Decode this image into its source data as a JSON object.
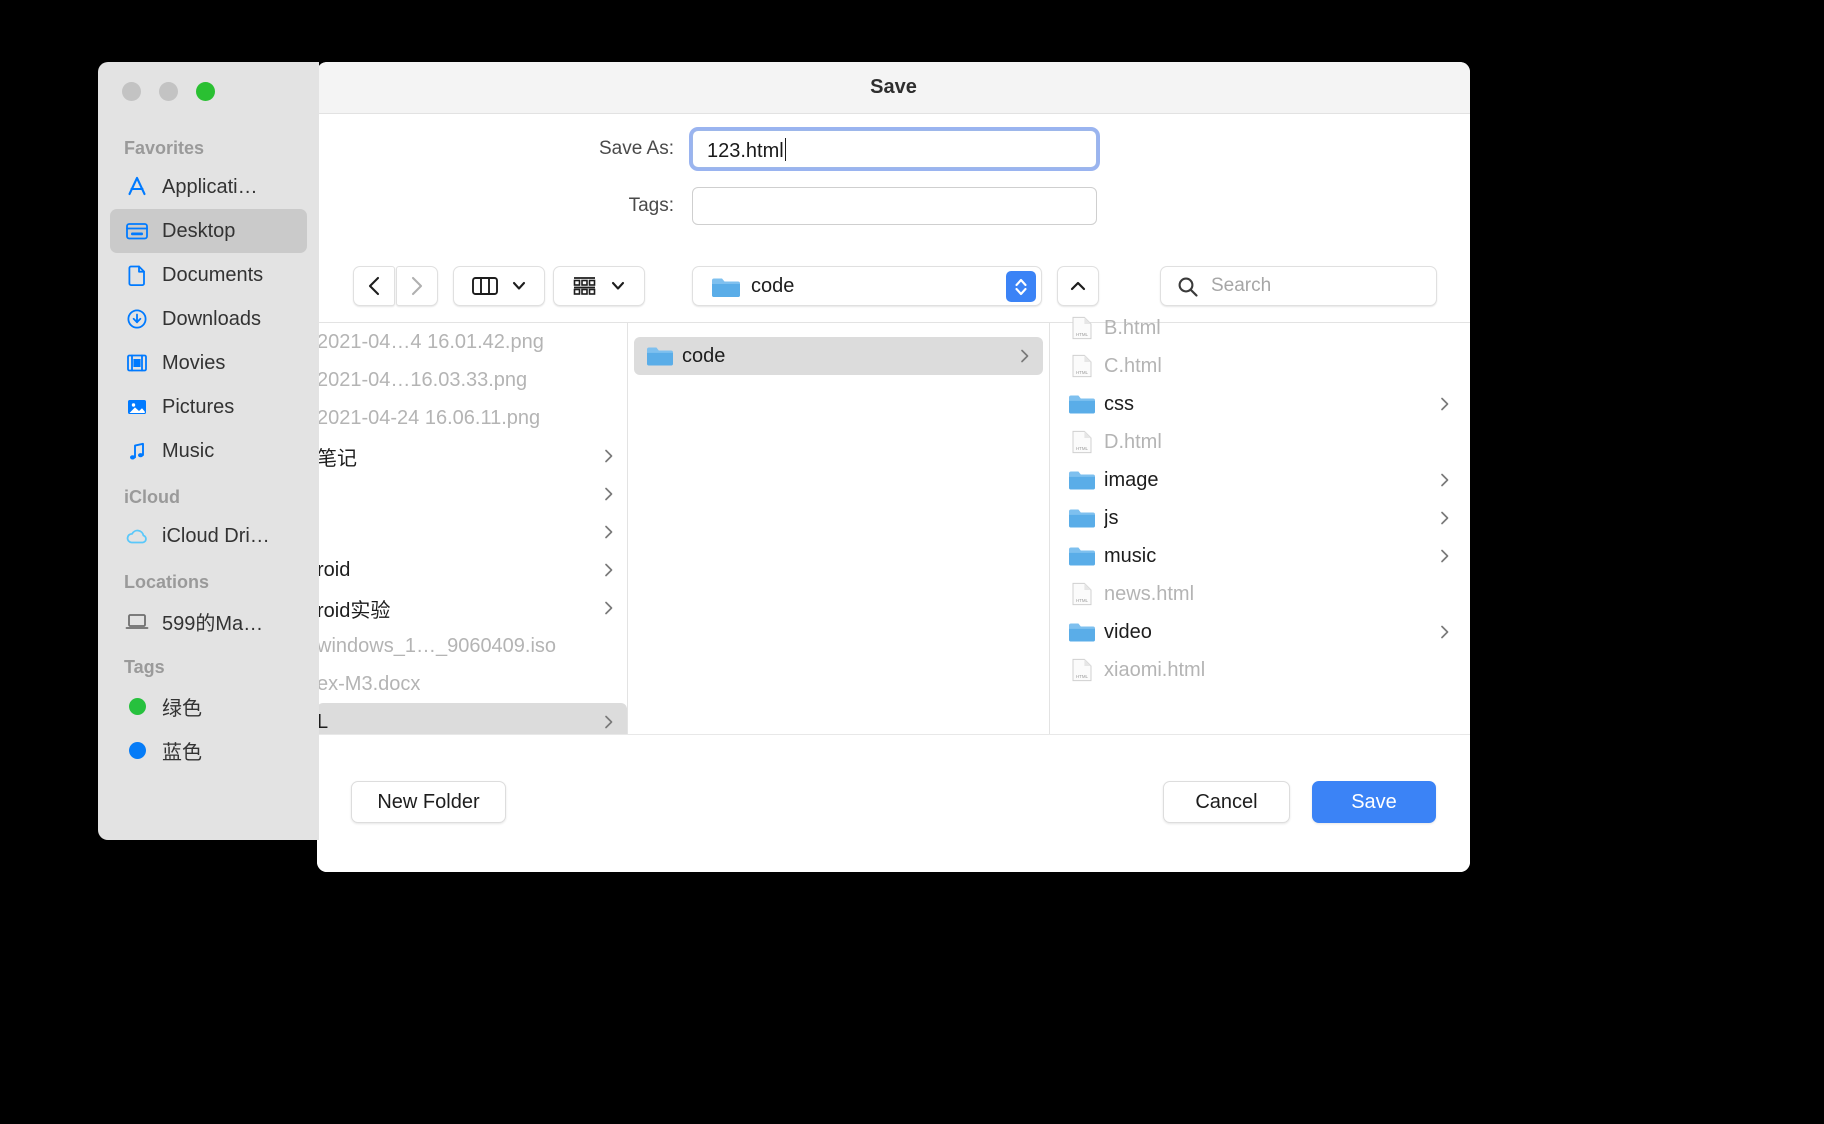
{
  "window": {
    "title": "Save",
    "traffic_lights": [
      "close",
      "minimize",
      "zoom"
    ]
  },
  "form": {
    "save_as_label": "Save As:",
    "save_as_value": "123.html",
    "tags_label": "Tags:",
    "tags_value": "",
    "tags_placeholder": ""
  },
  "toolbar": {
    "back_icon": "chevron-left-icon",
    "forward_icon": "chevron-right-icon",
    "view_mode_icon": "column-view-icon",
    "arrange_icon": "group-items-icon",
    "path_label": "code",
    "path_icon": "folder-icon",
    "stepper_icon": "up-down-chevron-icon",
    "up_icon": "chevron-up-icon",
    "search_icon": "search-icon",
    "search_placeholder": "Search",
    "search_value": ""
  },
  "sidebar": {
    "sections": [
      {
        "header": "Favorites",
        "items": [
          {
            "label": "Applicati…",
            "icon": "applications-icon",
            "color": "#007aff",
            "active": false
          },
          {
            "label": "Desktop",
            "icon": "desktop-icon",
            "color": "#007aff",
            "active": true
          },
          {
            "label": "Documents",
            "icon": "document-icon",
            "color": "#007aff",
            "active": false
          },
          {
            "label": "Downloads",
            "icon": "downloads-icon",
            "color": "#007aff",
            "active": false
          },
          {
            "label": "Movies",
            "icon": "movies-icon",
            "color": "#007aff",
            "active": false
          },
          {
            "label": "Pictures",
            "icon": "pictures-icon",
            "color": "#007aff",
            "active": false
          },
          {
            "label": "Music",
            "icon": "music-icon",
            "color": "#007aff",
            "active": false
          }
        ]
      },
      {
        "header": "iCloud",
        "items": [
          {
            "label": "iCloud Dri…",
            "icon": "icloud-icon",
            "color": "#5ac8fa",
            "active": false
          }
        ]
      },
      {
        "header": "Locations",
        "items": [
          {
            "label": "599的Ma…",
            "icon": "laptop-icon",
            "color": "#6e6e6e",
            "active": false
          }
        ]
      },
      {
        "header": "Tags",
        "items": [
          {
            "label": "绿色",
            "icon": "tag-dot-icon",
            "color": "#27c13e",
            "active": false
          },
          {
            "label": "蓝色",
            "icon": "tag-dot-icon",
            "color": "#067cf7",
            "active": false
          }
        ]
      }
    ]
  },
  "browser": {
    "column1": [
      {
        "label": "2021-04…4 16.01.42.png",
        "type": "file",
        "dim": true,
        "selected": false,
        "has_children": false
      },
      {
        "label": "2021-04…16.03.33.png",
        "type": "file",
        "dim": true,
        "selected": false,
        "has_children": false
      },
      {
        "label": "2021-04-24 16.06.11.png",
        "type": "file",
        "dim": true,
        "selected": false,
        "has_children": false
      },
      {
        "label": "笔记",
        "type": "folder",
        "dim": false,
        "selected": false,
        "has_children": true
      },
      {
        "label": "",
        "type": "folder",
        "dim": false,
        "selected": false,
        "has_children": true
      },
      {
        "label": "",
        "type": "folder",
        "dim": false,
        "selected": false,
        "has_children": true
      },
      {
        "label": "roid",
        "type": "folder",
        "dim": false,
        "selected": false,
        "has_children": true
      },
      {
        "label": "roid实验",
        "type": "folder",
        "dim": false,
        "selected": false,
        "has_children": true
      },
      {
        "label": "windows_1…_9060409.iso",
        "type": "file",
        "dim": true,
        "selected": false,
        "has_children": false
      },
      {
        "label": "ex-M3.docx",
        "type": "file",
        "dim": true,
        "selected": false,
        "has_children": false
      },
      {
        "label": "L",
        "type": "folder",
        "dim": false,
        "selected": true,
        "has_children": true
      }
    ],
    "column2": [
      {
        "label": "code",
        "type": "folder",
        "dim": false,
        "selected": true,
        "has_children": true
      }
    ],
    "column3": [
      {
        "label": "B.html",
        "type": "html",
        "dim": true,
        "selected": false,
        "has_children": false
      },
      {
        "label": "C.html",
        "type": "html",
        "dim": true,
        "selected": false,
        "has_children": false
      },
      {
        "label": "css",
        "type": "folder",
        "dim": false,
        "selected": false,
        "has_children": true
      },
      {
        "label": "D.html",
        "type": "html",
        "dim": true,
        "selected": false,
        "has_children": false
      },
      {
        "label": "image",
        "type": "folder",
        "dim": false,
        "selected": false,
        "has_children": true
      },
      {
        "label": "js",
        "type": "folder",
        "dim": false,
        "selected": false,
        "has_children": true
      },
      {
        "label": "music",
        "type": "folder",
        "dim": false,
        "selected": false,
        "has_children": true
      },
      {
        "label": "news.html",
        "type": "html",
        "dim": true,
        "selected": false,
        "has_children": false
      },
      {
        "label": "video",
        "type": "folder",
        "dim": false,
        "selected": false,
        "has_children": true
      },
      {
        "label": "xiaomi.html",
        "type": "html",
        "dim": true,
        "selected": false,
        "has_children": false
      }
    ]
  },
  "footer": {
    "new_folder_label": "New Folder",
    "cancel_label": "Cancel",
    "save_label": "Save"
  },
  "colors": {
    "accent": "#3b83f6",
    "sidebar_bg": "#e3e3e3",
    "selection": "#dcdcdc",
    "folder_blue": "#5aade8",
    "disabled_text": "#b4b4b4"
  }
}
